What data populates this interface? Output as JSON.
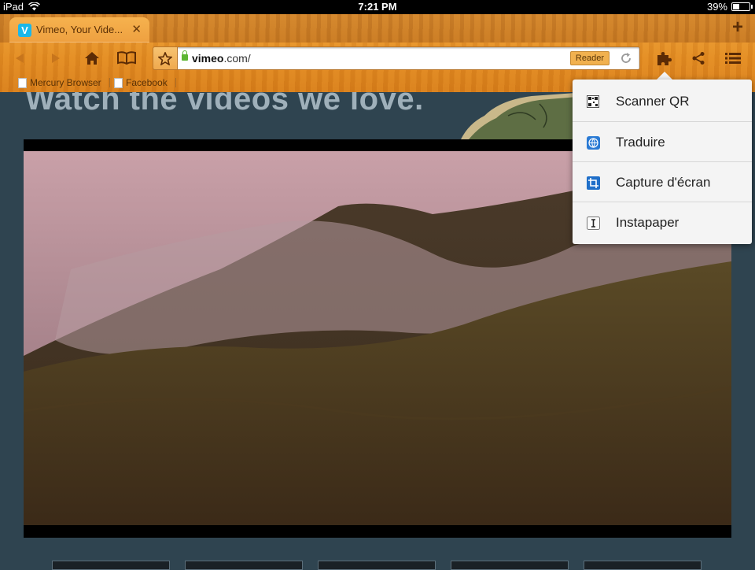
{
  "status_bar": {
    "device": "iPad",
    "time": "7:21 PM",
    "battery": "39%",
    "battery_level": 0.39
  },
  "tabs": [
    {
      "title": "Vimeo, Your Vide...",
      "favicon": "V"
    }
  ],
  "new_tab_label": "+",
  "address_bar": {
    "domain": "vimeo",
    "rest": ".com/",
    "reader_label": "Reader"
  },
  "bookmarks": [
    {
      "label": "Mercury Browser"
    },
    {
      "label": "Facebook"
    }
  ],
  "page": {
    "headline": "Watch the videos we love."
  },
  "extensions_menu": {
    "items": [
      {
        "label": "Scanner QR",
        "icon": "qr-code-icon"
      },
      {
        "label": "Traduire",
        "icon": "globe-icon"
      },
      {
        "label": "Capture d'écran",
        "icon": "crop-icon"
      },
      {
        "label": "Instapaper",
        "icon": "instapaper-icon"
      }
    ]
  },
  "colors": {
    "chrome_wood": "#e48c22",
    "page_bg": "#2f4450",
    "headline": "#9fb0ba",
    "vimeo_blue": "#1ab7ea"
  }
}
